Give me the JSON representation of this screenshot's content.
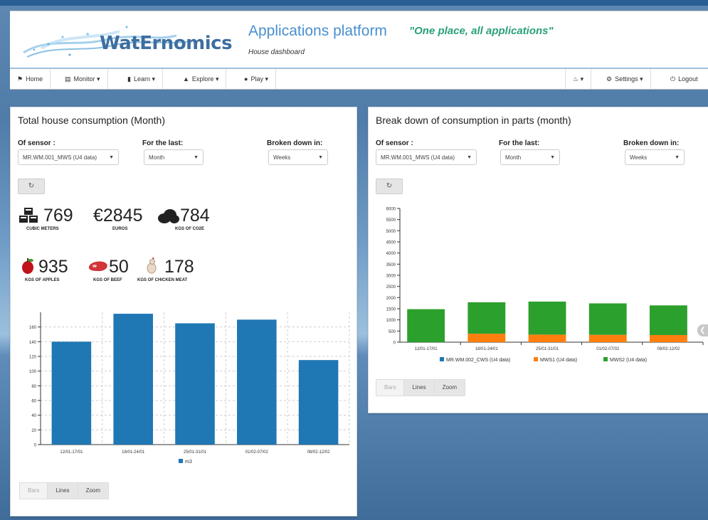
{
  "header": {
    "logo_text": "WatErnomics",
    "title": "Applications platform",
    "slogan": "\"One place, all applications\"",
    "subtitle": "House dashboard"
  },
  "nav": {
    "home": "Home",
    "monitor": "Monitor",
    "learn": "Learn",
    "explore": "Explore",
    "play": "Play",
    "settings": "Settings",
    "logout": "Logout"
  },
  "left_panel": {
    "title": "Total house consumption (Month)",
    "sensor_label": "Of sensor :",
    "sensor_value": "MR.WM.001_MWS (U4 data)",
    "period_label": "For the last:",
    "period_value": "Month",
    "breakdown_label": "Broken down in:",
    "breakdown_value": "Weeks",
    "stats": [
      {
        "value": "769",
        "label": "CUBIC METERS",
        "icon": "cubes-icon"
      },
      {
        "value": "2845",
        "label": "EUROS",
        "icon": "euro-icon"
      },
      {
        "value": "784",
        "label": "KGS OF CO2E",
        "icon": "cloud-icon"
      },
      {
        "value": "935",
        "label": "KGS OF APPLES",
        "icon": "apple-icon"
      },
      {
        "value": "50",
        "label": "KGS OF BEEF",
        "icon": "steak-icon"
      },
      {
        "value": "178",
        "label": "KGS OF CHICKEN MEAT",
        "icon": "chicken-icon"
      }
    ],
    "buttons": {
      "bars": "Bars",
      "lines": "Lines",
      "zoom": "Zoom"
    }
  },
  "right_panel": {
    "title": "Break down of consumption in parts (month)",
    "sensor_label": "Of sensor :",
    "sensor_value": "MR.WM.001_MWS (U4 data)",
    "period_label": "For the last:",
    "period_value": "Month",
    "breakdown_label": "Broken down in:",
    "breakdown_value": "Weeks",
    "buttons": {
      "bars": "Bars",
      "lines": "Lines",
      "zoom": "Zoom"
    }
  },
  "colors": {
    "bar_blue": "#1f77b4",
    "bar_orange": "#ff7f0e",
    "bar_green": "#2ca02c",
    "title_blue": "#4a90cf",
    "slogan_green": "#2aa07c"
  },
  "chart_data": [
    {
      "type": "bar",
      "categories": [
        "12/01-17/01",
        "18/01-24/01",
        "25/01-31/01",
        "01/02-07/02",
        "08/02-12/02"
      ],
      "series": [
        {
          "name": "m3",
          "values": [
            140,
            178,
            165,
            170,
            115
          ]
        }
      ],
      "ylim": [
        0,
        180
      ],
      "yticks": [
        0,
        20,
        40,
        60,
        80,
        100,
        120,
        140,
        160
      ],
      "grid": true,
      "legend": "bottom"
    },
    {
      "type": "bar",
      "stacked": true,
      "categories": [
        "12/01-17/01",
        "18/01-24/01",
        "25/01-31/01",
        "01/02-07/02",
        "08/02-12/02"
      ],
      "series": [
        {
          "name": "MR.WM.002_CWS (U4 data)",
          "values": [
            0,
            0,
            0,
            0,
            0
          ]
        },
        {
          "name": "MWS1 (U4 data)",
          "values": [
            0,
            380,
            340,
            330,
            320
          ]
        },
        {
          "name": "MWS2 (U4 data)",
          "values": [
            1480,
            1410,
            1480,
            1410,
            1330
          ]
        }
      ],
      "ylim": [
        0,
        6000
      ],
      "yticks": [
        0,
        500,
        1000,
        1500,
        2000,
        2500,
        3000,
        3500,
        4000,
        4500,
        5000,
        5500,
        6000
      ],
      "grid": false,
      "legend": "bottom"
    }
  ]
}
